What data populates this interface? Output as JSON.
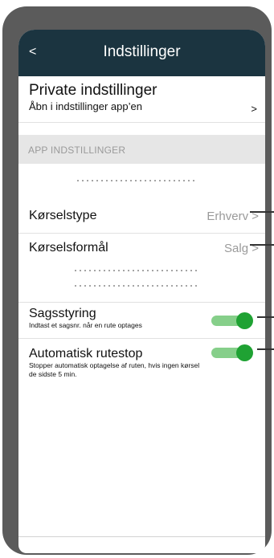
{
  "header": {
    "back_label": "<",
    "title": "Indstillinger"
  },
  "private_settings": {
    "title": "Private indstillinger",
    "subtitle": "Åbn i indstillinger app’en",
    "chevron": ">"
  },
  "app_settings": {
    "section_label": "APP INDSTILLINGER",
    "rows": [
      {
        "label": "Kørselstype",
        "value": "Erhverv >"
      },
      {
        "label": "Kørselsformål",
        "value": "Salg >"
      }
    ],
    "toggles": [
      {
        "title": "Sagsstyring",
        "description": "Indtast et sagsnr. når en rute optages",
        "on": true
      },
      {
        "title": "Automatisk rutestop",
        "description": "Stopper automatisk optagelse af ruten, hvis ingen kørsel de sidste 5 min.",
        "on": true
      }
    ]
  },
  "colors": {
    "header_bg": "#1b3440",
    "toggle_on_track": "#86cf8a",
    "toggle_on_knob": "#1fa233",
    "device_frame": "#5b5b5b"
  }
}
